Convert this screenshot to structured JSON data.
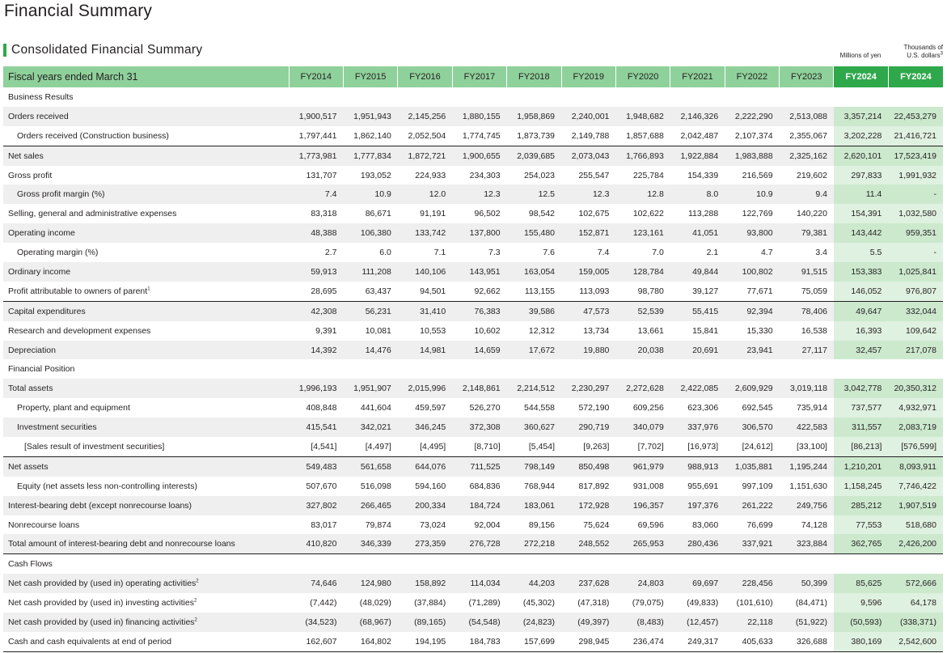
{
  "page_title": "Financial Summary",
  "section_title": "Consolidated Financial Summary",
  "unit_millions": "Millions of yen",
  "unit_thousands_line1": "Thousands of",
  "unit_thousands_line2": "U.S. dollars",
  "unit_thousands_sup": "3",
  "colors": {
    "header_light": "#8fd19b",
    "header_dark": "#2ea84a",
    "highlight": "#dff1e0",
    "row_shade": "#efefef"
  },
  "table": {
    "header_label": "Fiscal years ended March 31",
    "columns": [
      "FY2014",
      "FY2015",
      "FY2016",
      "FY2017",
      "FY2018",
      "FY2019",
      "FY2020",
      "FY2021",
      "FY2022",
      "FY2023",
      "FY2024",
      "FY2024"
    ],
    "rows": [
      {
        "type": "section",
        "label": "Business Results"
      },
      {
        "label": "Orders received",
        "indent": 0,
        "shade": true,
        "values": [
          "1,900,517",
          "1,951,943",
          "2,145,256",
          "1,880,155",
          "1,958,869",
          "2,240,001",
          "1,948,682",
          "2,146,326",
          "2,222,290",
          "2,513,088",
          "3,357,214",
          "22,453,279"
        ]
      },
      {
        "label": "Orders received (Construction business)",
        "indent": 1,
        "shade": false,
        "values": [
          "1,797,441",
          "1,862,140",
          "2,052,504",
          "1,774,745",
          "1,873,739",
          "2,149,788",
          "1,857,688",
          "2,042,487",
          "2,107,374",
          "2,355,067",
          "3,202,228",
          "21,416,721"
        ]
      },
      {
        "label": "Net sales",
        "indent": 0,
        "shade": true,
        "topline": true,
        "values": [
          "1,773,981",
          "1,777,834",
          "1,872,721",
          "1,900,655",
          "2,039,685",
          "2,073,043",
          "1,766,893",
          "1,922,884",
          "1,983,888",
          "2,325,162",
          "2,620,101",
          "17,523,419"
        ]
      },
      {
        "label": "Gross profit",
        "indent": 0,
        "shade": false,
        "values": [
          "131,707",
          "193,052",
          "224,933",
          "234,303",
          "254,023",
          "255,547",
          "225,784",
          "154,339",
          "216,569",
          "219,602",
          "297,833",
          "1,991,932"
        ]
      },
      {
        "label": "Gross profit margin (%)",
        "indent": 1,
        "shade": true,
        "values": [
          "7.4",
          "10.9",
          "12.0",
          "12.3",
          "12.5",
          "12.3",
          "12.8",
          "8.0",
          "10.9",
          "9.4",
          "11.4",
          "-"
        ]
      },
      {
        "label": "Selling, general and administrative expenses",
        "indent": 0,
        "shade": false,
        "values": [
          "83,318",
          "86,671",
          "91,191",
          "96,502",
          "98,542",
          "102,675",
          "102,622",
          "113,288",
          "122,769",
          "140,220",
          "154,391",
          "1,032,580"
        ]
      },
      {
        "label": "Operating income",
        "indent": 0,
        "shade": true,
        "values": [
          "48,388",
          "106,380",
          "133,742",
          "137,800",
          "155,480",
          "152,871",
          "123,161",
          "41,051",
          "93,800",
          "79,381",
          "143,442",
          "959,351"
        ]
      },
      {
        "label": "Operating margin (%)",
        "indent": 1,
        "shade": false,
        "values": [
          "2.7",
          "6.0",
          "7.1",
          "7.3",
          "7.6",
          "7.4",
          "7.0",
          "2.1",
          "4.7",
          "3.4",
          "5.5",
          "-"
        ]
      },
      {
        "label": "Ordinary income",
        "indent": 0,
        "shade": true,
        "values": [
          "59,913",
          "111,208",
          "140,106",
          "143,951",
          "163,054",
          "159,005",
          "128,784",
          "49,844",
          "100,802",
          "91,515",
          "153,383",
          "1,025,841"
        ]
      },
      {
        "label": "Profit attributable to owners of parent",
        "sup": "1",
        "indent": 0,
        "shade": false,
        "values": [
          "28,695",
          "63,437",
          "94,501",
          "92,662",
          "113,155",
          "113,093",
          "98,780",
          "39,127",
          "77,671",
          "75,059",
          "146,052",
          "976,807"
        ]
      },
      {
        "label": "Capital expenditures",
        "indent": 0,
        "shade": true,
        "topline": true,
        "values": [
          "42,308",
          "56,231",
          "31,410",
          "76,383",
          "39,586",
          "47,573",
          "52,539",
          "55,415",
          "92,394",
          "78,406",
          "49,647",
          "332,044"
        ]
      },
      {
        "label": "Research and development expenses",
        "indent": 0,
        "shade": false,
        "values": [
          "9,391",
          "10,081",
          "10,553",
          "10,602",
          "12,312",
          "13,734",
          "13,661",
          "15,841",
          "15,330",
          "16,538",
          "16,393",
          "109,642"
        ]
      },
      {
        "label": "Depreciation",
        "indent": 0,
        "shade": true,
        "values": [
          "14,392",
          "14,476",
          "14,981",
          "14,659",
          "17,672",
          "19,880",
          "20,038",
          "20,691",
          "23,941",
          "27,117",
          "32,457",
          "217,078"
        ]
      },
      {
        "type": "section",
        "label": "Financial Position"
      },
      {
        "label": "Total assets",
        "indent": 0,
        "shade": true,
        "values": [
          "1,996,193",
          "1,951,907",
          "2,015,996",
          "2,148,861",
          "2,214,512",
          "2,230,297",
          "2,272,628",
          "2,422,085",
          "2,609,929",
          "3,019,118",
          "3,042,778",
          "20,350,312"
        ]
      },
      {
        "label": "Property, plant and equipment",
        "indent": 1,
        "shade": false,
        "values": [
          "408,848",
          "441,604",
          "459,597",
          "526,270",
          "544,558",
          "572,190",
          "609,256",
          "623,306",
          "692,545",
          "735,914",
          "737,577",
          "4,932,971"
        ]
      },
      {
        "label": "Investment securities",
        "indent": 1,
        "shade": true,
        "values": [
          "415,541",
          "342,021",
          "346,245",
          "372,308",
          "360,627",
          "290,719",
          "340,079",
          "337,976",
          "306,570",
          "422,583",
          "311,557",
          "2,083,719"
        ]
      },
      {
        "label": "[Sales result of investment securities]",
        "indent": 2,
        "shade": false,
        "values": [
          "[4,541]",
          "[4,497]",
          "[4,495]",
          "[8,710]",
          "[5,454]",
          "[9,263]",
          "[7,702]",
          "[16,973]",
          "[24,612]",
          "[33,100]",
          "[86,213]",
          "[576,599]"
        ]
      },
      {
        "label": "Net assets",
        "indent": 0,
        "shade": true,
        "topline": true,
        "values": [
          "549,483",
          "561,658",
          "644,076",
          "711,525",
          "798,149",
          "850,498",
          "961,979",
          "988,913",
          "1,035,881",
          "1,195,244",
          "1,210,201",
          "8,093,911"
        ]
      },
      {
        "label": "Equity (net assets less non-controlling interests)",
        "indent": 1,
        "shade": false,
        "values": [
          "507,670",
          "516,098",
          "594,160",
          "684,836",
          "768,944",
          "817,892",
          "931,008",
          "955,691",
          "997,109",
          "1,151,630",
          "1,158,245",
          "7,746,422"
        ]
      },
      {
        "label": "Interest-bearing debt (except nonrecourse loans)",
        "indent": 0,
        "shade": true,
        "values": [
          "327,802",
          "266,465",
          "200,334",
          "184,724",
          "183,061",
          "172,928",
          "196,357",
          "197,376",
          "261,222",
          "249,756",
          "285,212",
          "1,907,519"
        ]
      },
      {
        "label": "Nonrecourse loans",
        "indent": 0,
        "shade": false,
        "values": [
          "83,017",
          "79,874",
          "73,024",
          "92,004",
          "89,156",
          "75,624",
          "69,596",
          "83,060",
          "76,699",
          "74,128",
          "77,553",
          "518,680"
        ]
      },
      {
        "label": "Total amount of interest-bearing debt and nonrecourse loans",
        "indent": 0,
        "shade": true,
        "values": [
          "410,820",
          "346,339",
          "273,359",
          "276,728",
          "272,218",
          "248,552",
          "265,953",
          "280,436",
          "337,921",
          "323,884",
          "362,765",
          "2,426,200"
        ]
      },
      {
        "type": "section",
        "label": "Cash Flows",
        "topline": true
      },
      {
        "label": "Net cash provided by (used in) operating activities",
        "sup": "2",
        "indent": 0,
        "shade": true,
        "values": [
          "74,646",
          "124,980",
          "158,892",
          "114,034",
          "44,203",
          "237,628",
          "24,803",
          "69,697",
          "228,456",
          "50,399",
          "85,625",
          "572,666"
        ]
      },
      {
        "label": "Net cash provided by (used in) investing activities",
        "sup": "2",
        "indent": 0,
        "shade": false,
        "values": [
          "(7,442)",
          "(48,029)",
          "(37,884)",
          "(71,289)",
          "(45,302)",
          "(47,318)",
          "(79,075)",
          "(49,833)",
          "(101,610)",
          "(84,471)",
          "9,596",
          "64,178"
        ]
      },
      {
        "label": "Net cash provided by (used in) financing activities",
        "sup": "2",
        "indent": 0,
        "shade": true,
        "values": [
          "(34,523)",
          "(68,967)",
          "(89,165)",
          "(54,548)",
          "(24,823)",
          "(49,397)",
          "(8,483)",
          "(12,457)",
          "22,118",
          "(51,922)",
          "(50,593)",
          "(338,371)"
        ]
      },
      {
        "label": "Cash and cash equivalents at end of period",
        "indent": 0,
        "shade": false,
        "last": true,
        "values": [
          "162,607",
          "164,802",
          "194,195",
          "184,783",
          "157,699",
          "298,945",
          "236,474",
          "249,317",
          "405,633",
          "326,688",
          "380,169",
          "2,542,600"
        ]
      }
    ]
  }
}
